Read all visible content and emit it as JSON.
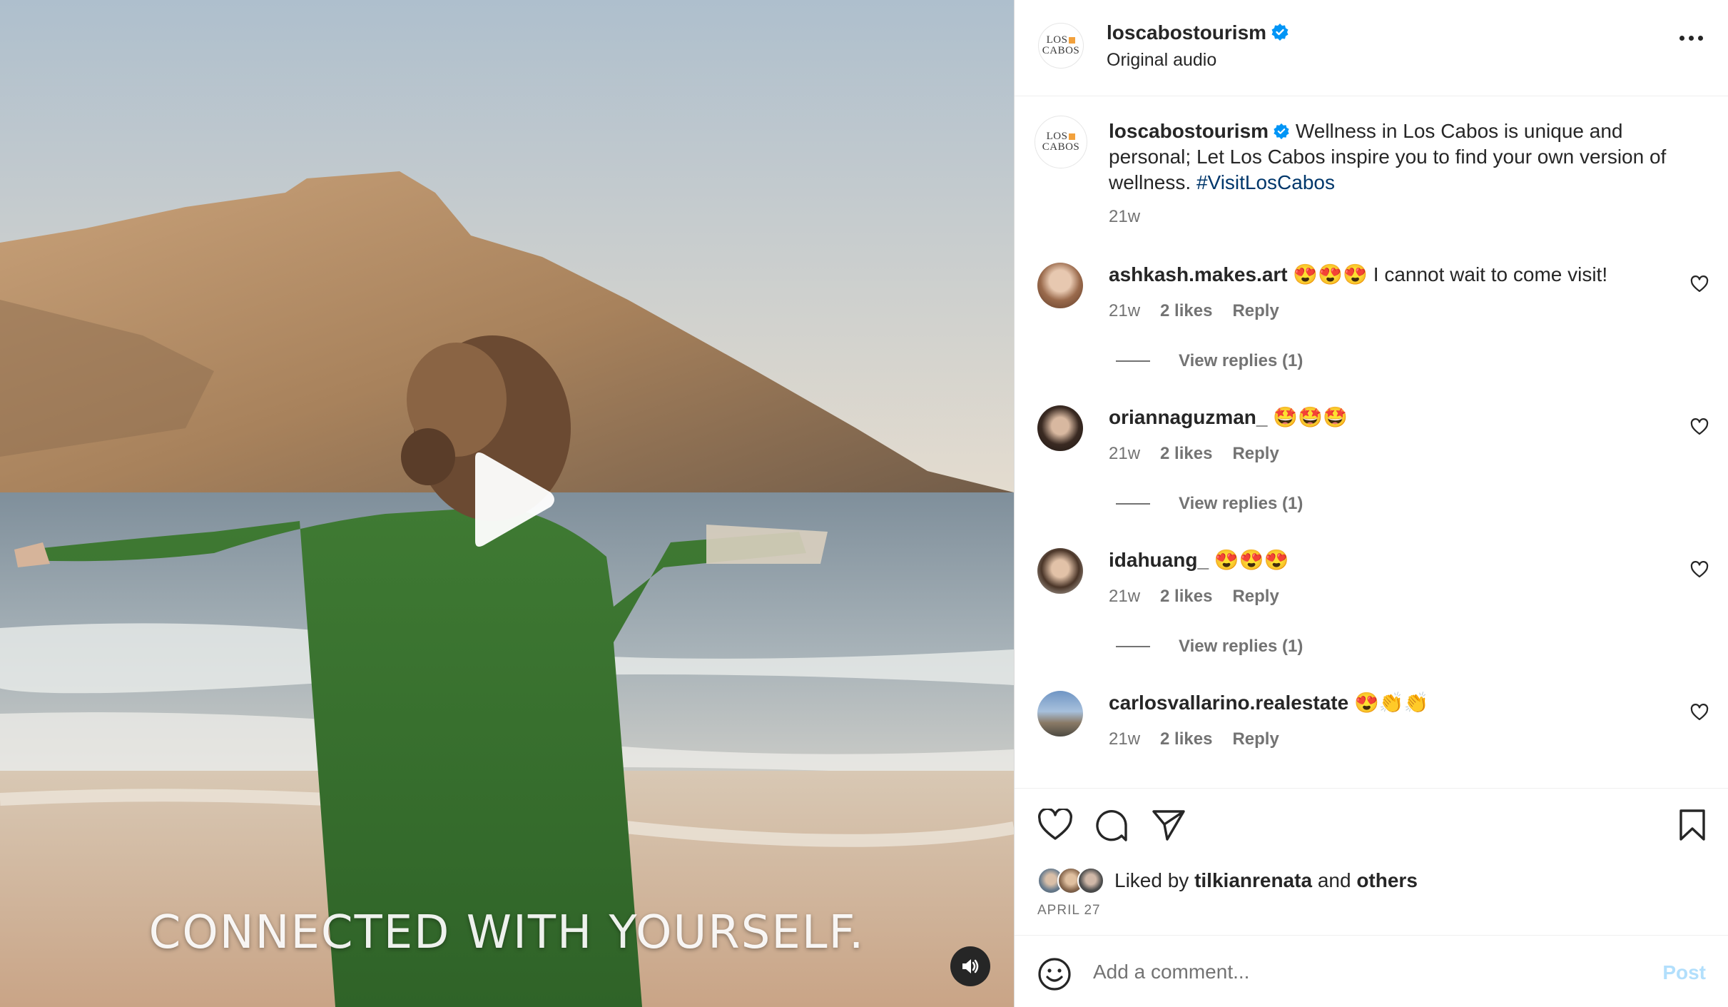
{
  "video": {
    "caption_overlay": "CONNECTED WITH YOURSELF."
  },
  "post_header": {
    "username": "loscabostourism",
    "subtitle": "Original audio",
    "logo_line1": "LOS",
    "logo_line2": "CABOS"
  },
  "caption": {
    "username": "loscabostourism",
    "text": "Wellness in Los Cabos is unique and personal; Let Los Cabos inspire you to find your own version of wellness.",
    "hashtag": "#VisitLosCabos",
    "time": "21w"
  },
  "comments": [
    {
      "username": "ashkash.makes.art",
      "text": "😍😍😍 I cannot wait to come visit!",
      "time": "21w",
      "likes": "2 likes",
      "reply": "Reply",
      "view_replies": "View replies (1)"
    },
    {
      "username": "oriannaguzman_",
      "text": "🤩🤩🤩",
      "time": "21w",
      "likes": "2 likes",
      "reply": "Reply",
      "view_replies": "View replies (1)"
    },
    {
      "username": "idahuang_",
      "text": "😍😍😍",
      "time": "21w",
      "likes": "2 likes",
      "reply": "Reply",
      "view_replies": "View replies (1)"
    },
    {
      "username": "carlosvallarino.realestate",
      "text": "😍👏👏",
      "time": "21w",
      "likes": "2 likes",
      "reply": "Reply"
    }
  ],
  "likes": {
    "prefix": "Liked by",
    "user": "tilkianrenata",
    "and": "and",
    "others": "others",
    "date": "APRIL 27"
  },
  "add_comment": {
    "placeholder": "Add a comment...",
    "post_label": "Post"
  },
  "icons": {
    "verified": "verified-badge-icon",
    "more": "more-options-icon",
    "heart": "heart-icon",
    "comment": "comment-icon",
    "share": "share-icon",
    "save": "bookmark-icon",
    "emoji": "emoji-icon",
    "play": "play-icon",
    "sound": "sound-on-icon"
  },
  "colors": {
    "verified_blue": "#0095f6",
    "hashtag": "#00376b",
    "muted_text": "#737373",
    "post_disabled": "#b2dffc"
  }
}
